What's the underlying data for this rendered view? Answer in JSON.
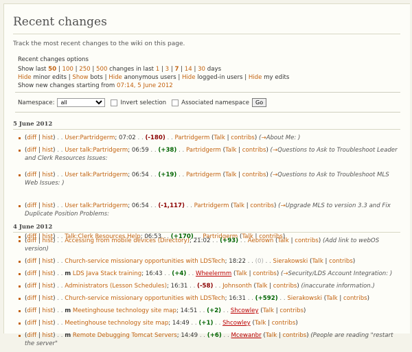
{
  "page": {
    "title": "Recent changes",
    "intro": "Track the most recent changes to the wiki on this page."
  },
  "options": {
    "heading": "Recent changes options",
    "show_last_label": "Show last",
    "limits": [
      "50",
      "100",
      "250",
      "500"
    ],
    "selected_limit": "50",
    "changes_in_last": "changes in last",
    "days": [
      "1",
      "3",
      "7",
      "14",
      "30"
    ],
    "selected_days": "7",
    "days_label": "days",
    "toggles": [
      {
        "action": "Hide",
        "label": "minor edits"
      },
      {
        "action": "Show",
        "label": "bots"
      },
      {
        "action": "Hide",
        "label": "anonymous users"
      },
      {
        "action": "Hide",
        "label": "logged-in users"
      },
      {
        "action": "Hide",
        "label": "my edits"
      }
    ],
    "show_new_label": "Show new changes starting from",
    "show_new_link": "07:14, 5 June 2012",
    "namespace_label": "Namespace:",
    "namespace_value": "all",
    "invert_label": "Invert selection",
    "associated_label": "Associated namespace",
    "go_label": "Go"
  },
  "days": [
    {
      "date": "5 June 2012",
      "changes": [
        {
          "minor": false,
          "page": "User:Partridgerm",
          "time": "07:02",
          "delta": "(-180)",
          "delta_class": "neg",
          "user": "Partridgerm",
          "user_red": false,
          "summary_arrow": "→",
          "summary": "About Me:  )",
          "summary_plain": ""
        },
        {
          "minor": false,
          "page": "User talk:Partridgerm",
          "time": "06:59",
          "delta": "(+38)",
          "delta_class": "pos",
          "user": "Partridgerm",
          "user_red": false,
          "summary_arrow": "→",
          "summary": "Questions to Ask to Troubleshoot Leader and Clerk Resources Issues:",
          "summary_plain": ""
        },
        {
          "minor": false,
          "page": "User talk:Partridgerm",
          "time": "06:54",
          "delta": "(+19)",
          "delta_class": "pos",
          "user": "Partridgerm",
          "user_red": false,
          "summary_arrow": "→",
          "summary": "Questions to Ask to Troubleshoot MLS Web Issues: )",
          "summary_plain": ""
        },
        {
          "minor": false,
          "page": "User talk:Partridgerm",
          "time": "06:54",
          "delta": "(-1,117)",
          "delta_class": "neg-big",
          "user": "Partridgerm",
          "user_red": false,
          "summary_arrow": "→",
          "summary": "Upgrade MLS to version 3.3 and Fix Duplicate Position Problems:",
          "summary_plain": ""
        },
        {
          "minor": false,
          "page": "Talk:Clerk Resources Help",
          "time": "06:53",
          "delta": "(+170)",
          "delta_class": "pos",
          "user": "Partridgerm",
          "user_red": false,
          "summary_arrow": "",
          "summary": "",
          "summary_plain": ""
        }
      ]
    },
    {
      "date": "4 June 2012",
      "changes": [
        {
          "minor": false,
          "page": "Accessing from mobile devices (Directory)",
          "time": "21:02",
          "delta": "(+93)",
          "delta_class": "pos",
          "user": "Aebrown",
          "user_red": false,
          "summary_arrow": "",
          "summary": "",
          "summary_plain": "(Add link to webOS version)"
        },
        {
          "minor": false,
          "page": "Church-service missionary opportunities with LDSTech",
          "time": "18:22",
          "delta": "(0)",
          "delta_class": "zero",
          "user": "Sierakowski",
          "user_red": false,
          "summary_arrow": "",
          "summary": "",
          "summary_plain": ""
        },
        {
          "minor": true,
          "page": "LDS Java Stack training",
          "time": "16:43",
          "delta": "(+4)",
          "delta_class": "pos",
          "user": "Wheelermm",
          "user_red": true,
          "summary_arrow": "→",
          "summary": "Security/LDS Account Integration:  )",
          "summary_plain": ""
        },
        {
          "minor": false,
          "page": "Administrators (Lesson Schedules)",
          "time": "16:31",
          "delta": "(-58)",
          "delta_class": "neg",
          "user": "Johnsonth",
          "user_red": false,
          "summary_arrow": "",
          "summary": "",
          "summary_plain": "(inaccurate information.)"
        },
        {
          "minor": false,
          "page": "Church-service missionary opportunities with LDSTech",
          "time": "16:31",
          "delta": "(+592)",
          "delta_class": "pos-big",
          "user": "Sierakowski",
          "user_red": false,
          "summary_arrow": "",
          "summary": "",
          "summary_plain": ""
        },
        {
          "minor": true,
          "page": "Meetinghouse technology site map",
          "time": "14:51",
          "delta": "(+2)",
          "delta_class": "pos",
          "user": "Shcowley",
          "user_red": true,
          "summary_arrow": "",
          "summary": "",
          "summary_plain": ""
        },
        {
          "minor": false,
          "page": "Meetinghouse technology site map",
          "time": "14:49",
          "delta": "(+1)",
          "delta_class": "pos",
          "user": "Shcowley",
          "user_red": true,
          "summary_arrow": "",
          "summary": "",
          "summary_plain": ""
        },
        {
          "minor": true,
          "page": "Remote Debugging Tomcat Servers",
          "time": "14:49",
          "delta": "(+6)",
          "delta_class": "pos",
          "user": "Mcewanbr",
          "user_red": true,
          "summary_arrow": "",
          "summary": "",
          "summary_plain": "(People are reading \"restart the server\""
        }
      ]
    }
  ],
  "labels": {
    "diff": "diff",
    "hist": "hist",
    "talk": "Talk",
    "contribs": "contribs",
    "minor_flag": "m",
    "sep": ". .",
    "bar": "|"
  }
}
